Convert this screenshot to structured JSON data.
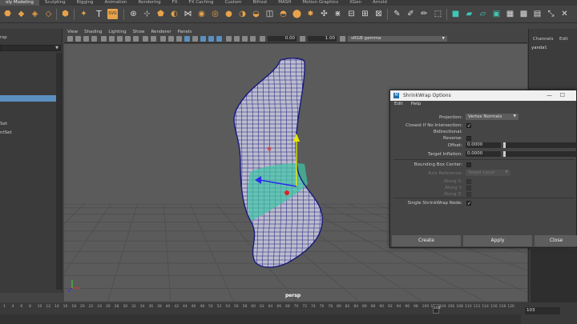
{
  "shelf_tabs": [
    "oly Modeling",
    "Sculpting",
    "Rigging",
    "Animation",
    "Rendering",
    "FX",
    "FX Caching",
    "Custom",
    "Bifrost",
    "MASH",
    "Motion Graphics",
    "XGen",
    "Arnold"
  ],
  "shelf_text_icon": "T",
  "shelf_svg_icon": "SVG",
  "viewport_menu": [
    "View",
    "Shading",
    "Lighting",
    "Show",
    "Renderer",
    "Panels"
  ],
  "viewport_toolbar": {
    "exposure": "0.00",
    "gamma": "1.00",
    "colorspace": "sRGB gamma"
  },
  "left_panel": {
    "top_text": "rsp",
    "items": [
      "Set",
      "ntSet"
    ]
  },
  "viewport": {
    "camera_label": "persp"
  },
  "right_panel": {
    "tabs": [
      "Channels",
      "Edit"
    ],
    "object_name": "yandal"
  },
  "timeline": {
    "ticks": [
      "1",
      "4",
      "6",
      "8",
      "10",
      "12",
      "14",
      "16",
      "18",
      "20",
      "22",
      "24",
      "26",
      "28",
      "30",
      "32",
      "34",
      "36",
      "38",
      "40",
      "42",
      "44",
      "46",
      "48",
      "50",
      "52",
      "54",
      "56",
      "58",
      "60",
      "62",
      "64",
      "66",
      "68",
      "70",
      "72",
      "74",
      "76",
      "78",
      "80",
      "82",
      "84",
      "86",
      "88",
      "90",
      "92",
      "94",
      "96",
      "98",
      "100",
      "102",
      "104",
      "106",
      "108",
      "110",
      "112",
      "114",
      "116",
      "118",
      "120"
    ],
    "current_frame": "103",
    "frame_field": "103"
  },
  "dialog": {
    "title": "ShrinkWrap Options",
    "menu": [
      "Edit",
      "Help"
    ],
    "projection_label": "Projection:",
    "projection_value": "Vertex Normals",
    "closest_label": "Closest If No Intersection:",
    "bidirectional_label": "Bidirectional:",
    "reverse_label": "Reverse:",
    "offset_label": "Offset:",
    "offset_value": "0.0000",
    "target_inflation_label": "Target Inflation:",
    "target_inflation_value": "0.0000",
    "bbox_label": "Bounding Box Center:",
    "axis_ref_label": "Axis Reference:",
    "axis_ref_value": "Target Local",
    "along_x_label": "Along X:",
    "along_y_label": "Along Y:",
    "along_z_label": "Along Z:",
    "single_node_label": "Single ShrinkWrap Node:",
    "create": "Create",
    "apply": "Apply",
    "close": "Close",
    "checks": {
      "closest": true,
      "bidirectional": false,
      "reverse": false,
      "bbox": false,
      "along_x": false,
      "along_y": false,
      "along_z": false,
      "single_node": true
    }
  },
  "colors": {
    "wire": "#1a1a7a",
    "selection": "#3ec6a7",
    "accent": "#e8a24a",
    "selected_row": "#5a8fc0"
  }
}
